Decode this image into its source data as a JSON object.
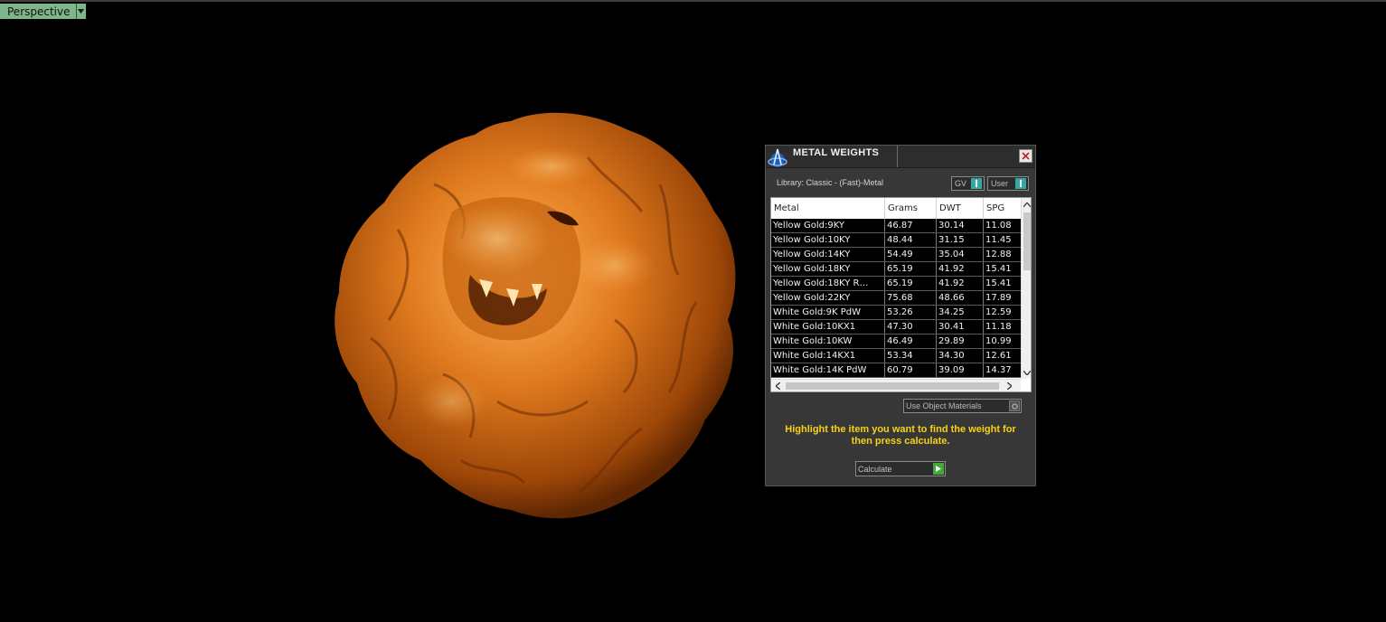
{
  "viewport": {
    "view_label": "Perspective",
    "dropdown_icon": "chevron-down-icon",
    "model_color": "#d8731c"
  },
  "panel": {
    "title": "METAL WEIGHTS",
    "library_label": "Library: Classic - (Fast)-Metal",
    "toggle_gv": "GV",
    "toggle_user": "User",
    "columns": [
      "Metal",
      "Grams",
      "DWT",
      "SPG"
    ],
    "rows": [
      [
        "Yellow Gold:9KY",
        "46.87",
        "30.14",
        "11.08"
      ],
      [
        "Yellow Gold:10KY",
        "48.44",
        "31.15",
        "11.45"
      ],
      [
        "Yellow Gold:14KY",
        "54.49",
        "35.04",
        "12.88"
      ],
      [
        "Yellow Gold:18KY",
        "65.19",
        "41.92",
        "15.41"
      ],
      [
        "Yellow Gold:18KY R…",
        "65.19",
        "41.92",
        "15.41"
      ],
      [
        "Yellow Gold:22KY",
        "75.68",
        "48.66",
        "17.89"
      ],
      [
        "White Gold:9K PdW",
        "53.26",
        "34.25",
        "12.59"
      ],
      [
        "White Gold:10KX1",
        "47.30",
        "30.41",
        "11.18"
      ],
      [
        "White Gold:10KW",
        "46.49",
        "29.89",
        "10.99"
      ],
      [
        "White Gold:14KX1",
        "53.34",
        "34.30",
        "12.61"
      ],
      [
        "White Gold:14K PdW",
        "60.79",
        "39.09",
        "14.37"
      ]
    ],
    "materials_dropdown": "Use Object Materials",
    "hint": "Highlight the item you want to find the weight for then press calculate.",
    "calculate_label": "Calculate",
    "hint_color": "#f6d312",
    "accent_teal": "#3aa6a0",
    "accent_green": "#47a53a"
  }
}
